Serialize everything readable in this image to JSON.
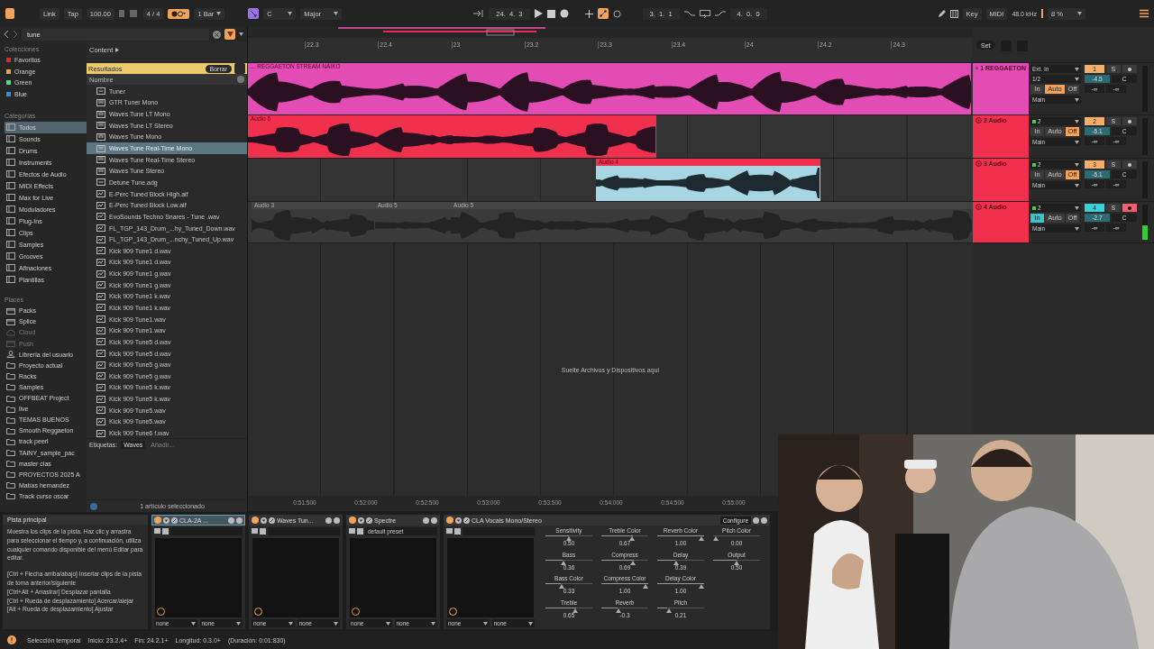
{
  "toolbar": {
    "link": "Link",
    "tap": "Tap",
    "tempo": "100.00",
    "signature": "4 / 4",
    "quantize": "1 Bar",
    "key": "C",
    "scale": "Major",
    "position": "24.  4.  3",
    "loop_start": "3.  1.  1",
    "loop_length": "4.  0.  0",
    "key_map": "Key",
    "midi_map": "MIDI",
    "sample_rate": "48.0 kHz",
    "cpu": "8 %"
  },
  "browser": {
    "search": "tune",
    "collections_heading": "Colecciones",
    "collections": [
      {
        "label": "Favoritos",
        "color": "#e02828"
      },
      {
        "label": "Orange",
        "color": "#f0a040"
      },
      {
        "label": "Green",
        "color": "#3ee08a"
      },
      {
        "label": "Blue",
        "color": "#2f8fe0"
      }
    ],
    "categories_heading": "Categorías",
    "categories": [
      {
        "label": "Todos",
        "selected": true
      },
      {
        "label": "Sounds",
        "selected": false
      },
      {
        "label": "Drums",
        "selected": false
      },
      {
        "label": "Instruments",
        "selected": false
      },
      {
        "label": "Efectos de Audio",
        "selected": false
      },
      {
        "label": "MIDI Effects",
        "selected": false
      },
      {
        "label": "Max for Live",
        "selected": false
      },
      {
        "label": "Moduladores",
        "selected": false
      },
      {
        "label": "Plug-Ins",
        "selected": false
      },
      {
        "label": "Clips",
        "selected": false
      },
      {
        "label": "Samples",
        "selected": false
      },
      {
        "label": "Grooves",
        "selected": false
      },
      {
        "label": "Afinaciones",
        "selected": false
      },
      {
        "label": "Plantillas",
        "selected": false
      }
    ],
    "places_heading": "Places",
    "places": [
      {
        "label": "Packs",
        "disabled": false,
        "kind": "pack"
      },
      {
        "label": "Splice",
        "disabled": false,
        "kind": "pack"
      },
      {
        "label": "Cloud",
        "disabled": true,
        "kind": "cloud"
      },
      {
        "label": "Push",
        "disabled": true,
        "kind": "pack"
      },
      {
        "label": "Librería del usuario",
        "disabled": false,
        "kind": "user"
      },
      {
        "label": "Proyecto actual",
        "disabled": false,
        "kind": "folder"
      },
      {
        "label": "Racks",
        "disabled": false,
        "kind": "folder"
      },
      {
        "label": "Samples",
        "disabled": false,
        "kind": "folder"
      },
      {
        "label": "OFFBEAT Project",
        "disabled": false,
        "kind": "folder"
      },
      {
        "label": "live",
        "disabled": false,
        "kind": "folder"
      },
      {
        "label": "TEMAS BUENOS",
        "disabled": false,
        "kind": "folder"
      },
      {
        "label": "Smooth Reggaeton",
        "disabled": false,
        "kind": "folder"
      },
      {
        "label": "track peerl",
        "disabled": false,
        "kind": "folder"
      },
      {
        "label": "TAINY_sample_pac",
        "disabled": false,
        "kind": "folder"
      },
      {
        "label": "master clas",
        "disabled": false,
        "kind": "folder"
      },
      {
        "label": "PROYECTOS 2025 A",
        "disabled": false,
        "kind": "folder"
      },
      {
        "label": "Matías hernandez",
        "disabled": false,
        "kind": "folder"
      },
      {
        "label": "Track curso oscar",
        "disabled": false,
        "kind": "folder"
      }
    ],
    "breadcrumb": "Content",
    "results_label": "Resultados",
    "clear_button": "Borrar",
    "column": "Nombre",
    "items": [
      {
        "name": "Tuner",
        "selected": false,
        "kind": "device"
      },
      {
        "name": "GTR Tuner Mono",
        "selected": false,
        "kind": "plugin"
      },
      {
        "name": "Waves Tune LT Mono",
        "selected": false,
        "kind": "plugin"
      },
      {
        "name": "Waves Tune LT Stereo",
        "selected": false,
        "kind": "plugin"
      },
      {
        "name": "Waves Tune Mono",
        "selected": false,
        "kind": "plugin"
      },
      {
        "name": "Waves Tune Real-Time Mono",
        "selected": true,
        "kind": "plugin"
      },
      {
        "name": "Waves Tune Real-Time Stereo",
        "selected": false,
        "kind": "plugin"
      },
      {
        "name": "Waves Tune Stereo",
        "selected": false,
        "kind": "plugin"
      },
      {
        "name": "Detune Tune.adg",
        "selected": false,
        "kind": "device"
      },
      {
        "name": "E-Perc Tuned Block High.aif",
        "selected": false,
        "kind": "audio"
      },
      {
        "name": "E-Perc Tuned Block Low.aif",
        "selected": false,
        "kind": "audio"
      },
      {
        "name": "EvoSounds Techno Snares - Tune  .wav",
        "selected": false,
        "kind": "audio"
      },
      {
        "name": "FL_TGP_143_Drum_...hy_Tuned_Down.wav",
        "selected": false,
        "kind": "audio"
      },
      {
        "name": "FL_TGP_143_Drum_...nchy_Tuned_Up.wav",
        "selected": false,
        "kind": "audio"
      },
      {
        "name": "Kick 909 Tune1 d.wav",
        "selected": false,
        "kind": "audio"
      },
      {
        "name": "Kick 909 Tune1 d.wav",
        "selected": false,
        "kind": "audio"
      },
      {
        "name": "Kick 909 Tune1 g.wav",
        "selected": false,
        "kind": "audio"
      },
      {
        "name": "Kick 909 Tune1 g.wav",
        "selected": false,
        "kind": "audio"
      },
      {
        "name": "Kick 909 Tune1 k.wav",
        "selected": false,
        "kind": "audio"
      },
      {
        "name": "Kick 909 Tune1 k.wav",
        "selected": false,
        "kind": "audio"
      },
      {
        "name": "Kick 909 Tune1.wav",
        "selected": false,
        "kind": "audio"
      },
      {
        "name": "Kick 909 Tune1.wav",
        "selected": false,
        "kind": "audio"
      },
      {
        "name": "Kick 909 Tune5 d.wav",
        "selected": false,
        "kind": "audio"
      },
      {
        "name": "Kick 909 Tune5 d.wav",
        "selected": false,
        "kind": "audio"
      },
      {
        "name": "Kick 909 Tune5 g.wav",
        "selected": false,
        "kind": "audio"
      },
      {
        "name": "Kick 909 Tune5 g.wav",
        "selected": false,
        "kind": "audio"
      },
      {
        "name": "Kick 909 Tune5 k.wav",
        "selected": false,
        "kind": "audio"
      },
      {
        "name": "Kick 909 Tune5 k.wav",
        "selected": false,
        "kind": "audio"
      },
      {
        "name": "Kick 909 Tune5.wav",
        "selected": false,
        "kind": "audio"
      },
      {
        "name": "Kick 909 Tune5.wav",
        "selected": false,
        "kind": "audio"
      },
      {
        "name": "Kick 909 Tune6 f.wav",
        "selected": false,
        "kind": "audio"
      }
    ],
    "tags_label": "Etiquetas:",
    "tag": "Waves",
    "tag_placeholder": "Añadir...",
    "footer": "1 artículo seleccionado"
  },
  "ruler": {
    "ticks": [
      "22.3",
      "22.4",
      "23",
      "23.2",
      "23.3",
      "23.4",
      "24",
      "24.2",
      "24.3"
    ],
    "set_button": "Set"
  },
  "tracks": [
    {
      "name": "1 REGGAETON",
      "color": "#e24cb4",
      "selected": false,
      "armed": false,
      "input": "Ext. In",
      "channel": "1/2",
      "monitor": [
        {
          "label": "In",
          "selected": false
        },
        {
          "label": "Auto",
          "selected": true
        },
        {
          "label": "Off",
          "selected": false
        }
      ],
      "output": "Main",
      "number": "1",
      "volume": "-4.5",
      "pan": "C",
      "solo": "S",
      "sends": [
        "-∞",
        "-∞"
      ],
      "clips": [
        {
          "name": "... REGGAETON STREAM NAIKO",
          "selected": false,
          "muted": false
        }
      ]
    },
    {
      "name": "2 Audio",
      "color": "#f0304c",
      "selected": false,
      "armed": false,
      "input": "2",
      "monitor": [
        {
          "label": "In",
          "selected": false
        },
        {
          "label": "Auto",
          "selected": false
        },
        {
          "label": "Off",
          "selected": true
        }
      ],
      "output": "Main",
      "number": "2",
      "volume": "-5.1",
      "pan": "C",
      "solo": "S",
      "sends": [
        "-∞",
        "-∞"
      ],
      "clips": [
        {
          "name": "Audio 6",
          "selected": false,
          "muted": false
        }
      ]
    },
    {
      "name": "3 Audio",
      "color": "#f0304c",
      "selected": false,
      "armed": false,
      "input": "2",
      "monitor": [
        {
          "label": "In",
          "selected": false
        },
        {
          "label": "Auto",
          "selected": false
        },
        {
          "label": "Off",
          "selected": true
        }
      ],
      "output": "Main",
      "number": "3",
      "volume": "-5.1",
      "pan": "C",
      "solo": "S",
      "sends": [
        "-∞",
        "-∞"
      ],
      "clips": [
        {
          "name": "Audio 4",
          "selected": true,
          "muted": false
        }
      ]
    },
    {
      "name": "4 Audio",
      "color": "#f0304c",
      "selected": true,
      "armed": true,
      "input": "2",
      "monitor": [
        {
          "label": "In",
          "selected": true
        },
        {
          "label": "Auto",
          "selected": false
        },
        {
          "label": "Off",
          "selected": false
        }
      ],
      "output": "Main",
      "number": "4",
      "volume": "-2.7",
      "pan": "C",
      "solo": "S",
      "sends": [
        "-∞",
        "-∞"
      ],
      "clips": [
        {
          "name": "Audio 3",
          "selected": false,
          "muted": true
        },
        {
          "name": "Audio 5",
          "selected": false,
          "muted": true
        },
        {
          "name": "Audio 5",
          "selected": false,
          "muted": true
        }
      ]
    }
  ],
  "drop_hint": "Suelte Archivos y Dispositivos aquí",
  "time_ruler": [
    "0:51:500",
    "0:52:000",
    "0:52:500",
    "0:53:000",
    "0:53:500",
    "0:54:000",
    "0:54:500",
    "0:55:000"
  ],
  "info": {
    "title": "Pista principal",
    "paragraphs": [
      "Muestra los clips de la pista. Haz clic y arrastra para seleccionar el tiempo y, a continuación, utiliza cualquier comando disponible del menú Editar para editar.",
      "[Ctrl + Flecha arriba/abajo] Insertar clips de la pista de toma anterior/siguiente",
      "[Ctrl+Alt + Arrastrar] Desplazar pantalla",
      "[Ctrl + Rueda de desplazamiento] Acercar/alejar",
      "[Alt + Rueda de desplazamiento] Ajustar"
    ]
  },
  "devices": [
    {
      "name": "CLA-2A ...",
      "selected": true,
      "sidechain": [
        "none",
        "none"
      ]
    },
    {
      "name": "Waves Tun...",
      "selected": false,
      "sidechain": [
        "none",
        "none"
      ]
    },
    {
      "name": "Spectre",
      "selected": false,
      "preset": "default preset",
      "sidechain": [
        "none",
        "none"
      ]
    },
    {
      "name": "CLA Vocals Mono/Stereo",
      "selected": false,
      "sidechain": [
        "none",
        "none"
      ],
      "configure": "Configure",
      "params": [
        [
          {
            "label": "Sensitivity",
            "value": "0.50",
            "level": 0.5
          },
          {
            "label": "Bass",
            "value": "0.36",
            "level": 0.36
          },
          {
            "label": "Bass Color",
            "value": "0.33",
            "level": 0.33
          },
          {
            "label": "Treble",
            "value": "0.65",
            "level": 0.65
          }
        ],
        [
          {
            "label": "Treble Color",
            "value": "0.67",
            "level": 0.67
          },
          {
            "label": "Compress",
            "value": "0.69",
            "level": 0.69
          },
          {
            "label": "Compress Color",
            "value": "1.00",
            "level": 1
          },
          {
            "label": "Reverb",
            "value": "-0.3",
            "level": 0.35
          }
        ],
        [
          {
            "label": "Reverb Color",
            "value": "1.00",
            "level": 1
          },
          {
            "label": "Delay",
            "value": "0.39",
            "level": 0.39
          },
          {
            "label": "Delay Color",
            "value": "1.00",
            "level": 1
          },
          {
            "label": "Pitch",
            "value": "0.21",
            "level": 0.21
          }
        ],
        [
          {
            "label": "Pitch Color",
            "value": "0.00",
            "level": 0
          },
          {
            "label": "Output",
            "value": "0.50",
            "level": 0.5
          }
        ]
      ]
    }
  ],
  "status": [
    "Selección temporal",
    "Inicio: 23.2.4+",
    "Fin: 24.2.1+",
    "Longitud: 0.3.0+",
    "(Duración: 0:01:830)"
  ],
  "webcam": {
    "kind": "picture"
  }
}
